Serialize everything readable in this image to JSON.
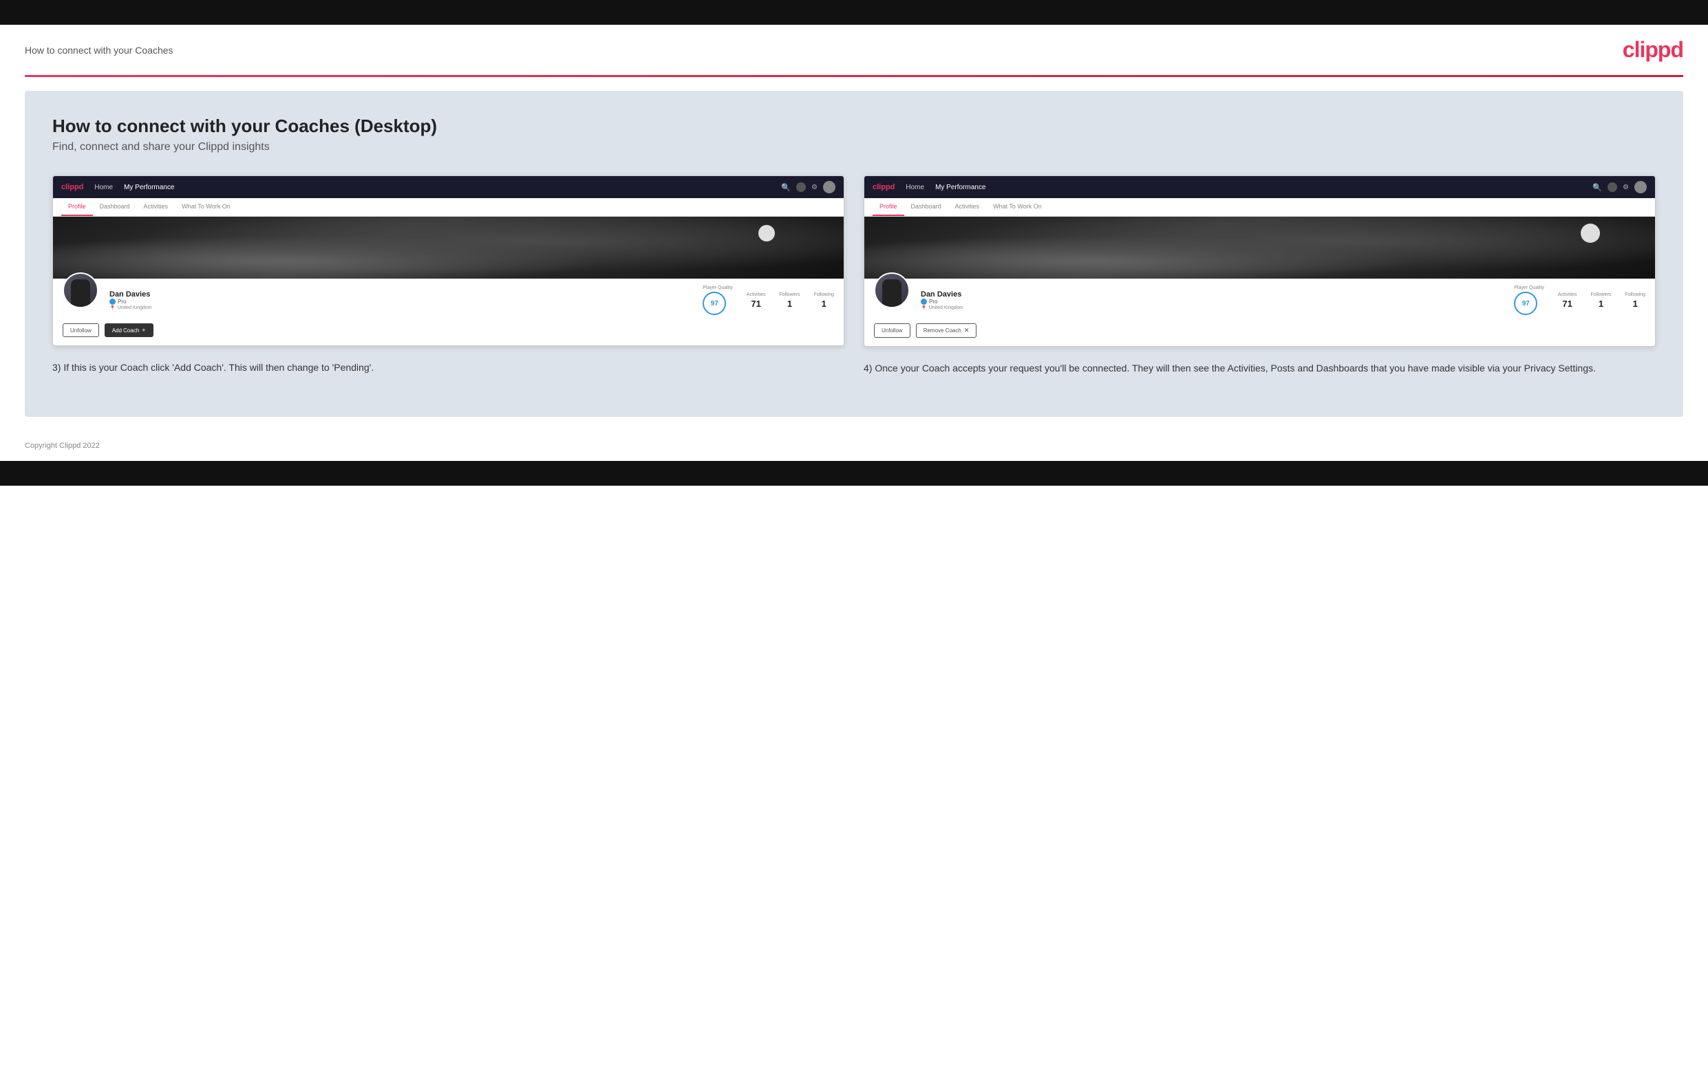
{
  "header": {
    "title": "How to connect with your Coaches",
    "logo": "clippd"
  },
  "page": {
    "heading": "How to connect with your Coaches (Desktop)",
    "subheading": "Find, connect and share your Clippd insights"
  },
  "screenshot_left": {
    "navbar": {
      "logo": "clippd",
      "links": [
        "Home",
        "My Performance"
      ],
      "active_link": "My Performance"
    },
    "tabs": [
      "Profile",
      "Dashboard",
      "Activities",
      "What To Work On"
    ],
    "active_tab": "Profile",
    "profile": {
      "name": "Dan Davies",
      "pro_label": "Pro",
      "location": "United Kingdom",
      "player_quality_label": "Player Quality",
      "player_quality_value": "97",
      "activities_label": "Activities",
      "activities_value": "71",
      "followers_label": "Followers",
      "followers_value": "1",
      "following_label": "Following",
      "following_value": "1"
    },
    "buttons": {
      "unfollow": "Unfollow",
      "add_coach": "Add Coach"
    }
  },
  "screenshot_right": {
    "navbar": {
      "logo": "clippd",
      "links": [
        "Home",
        "My Performance"
      ],
      "active_link": "My Performance"
    },
    "tabs": [
      "Profile",
      "Dashboard",
      "Activities",
      "What To Work On"
    ],
    "active_tab": "Profile",
    "profile": {
      "name": "Dan Davies",
      "pro_label": "Pro",
      "location": "United Kingdom",
      "player_quality_label": "Player Quality",
      "player_quality_value": "97",
      "activities_label": "Activities",
      "activities_value": "71",
      "followers_label": "Followers",
      "followers_value": "1",
      "following_label": "Following",
      "following_value": "1"
    },
    "buttons": {
      "unfollow": "Unfollow",
      "remove_coach": "Remove Coach"
    }
  },
  "captions": {
    "left": "3) If this is your Coach click 'Add Coach'. This will then change to 'Pending'.",
    "right": "4) Once your Coach accepts your request you'll be connected. They will then see the Activities, Posts and Dashboards that you have made visible via your Privacy Settings."
  },
  "footer": {
    "copyright": "Copyright Clippd 2022"
  }
}
